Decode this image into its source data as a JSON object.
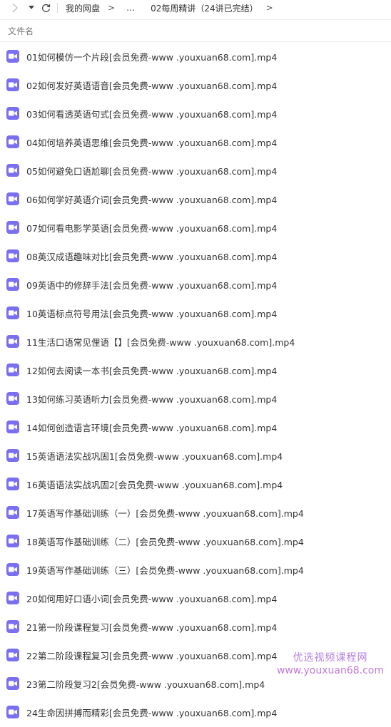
{
  "toolbar": {
    "breadcrumb_root": "我的网盘",
    "breadcrumb_ellipsis": "…",
    "breadcrumb_current": "02每周精讲（24讲已完结）",
    "separator": ">"
  },
  "column_header": {
    "name": "文件名"
  },
  "colors": {
    "video_icon": "#7a6ff0",
    "watermark": "#c07ad8"
  },
  "files": [
    "01如何模仿一个片段[会员免费-www .youxuan68.com].mp4",
    "02如何发好英语语音[会员免费-www .youxuan68.com].mp4",
    "03如何看透英语句式[会员免费-www .youxuan68.com].mp4",
    "04如何培养英语思维[会员免费-www .youxuan68.com].mp4",
    "05如何避免口语尬聊[会员免费-www .youxuan68.com].mp4",
    "06如何学好英语介词[会员免费-www .youxuan68.com].mp4",
    "07如何看电影学英语[会员免费-www .youxuan68.com].mp4",
    "08英汉成语趣味对比[会员免费-www .youxuan68.com].mp4",
    "09英语中的修辞手法[会员免费-www .youxuan68.com].mp4",
    "10英语标点符号用法[会员免费-www .youxuan68.com].mp4",
    "11生活口语常见俚语【】[会员免费-www .youxuan68.com].mp4",
    "12如何去阅读一本书[会员免费-www .youxuan68.com].mp4",
    "13如何练习英语听力[会员免费-www .youxuan68.com].mp4",
    "14如何创造语言环境[会员免费-www .youxuan68.com].mp4",
    "15英语语法实战巩固1[会员免费-www .youxuan68.com].mp4",
    "16英语语法实战巩固2[会员免费-www .youxuan68.com].mp4",
    "17英语写作基础训练（一）[会员免费-www .youxuan68.com].mp4",
    "18英语写作基础训练（二）[会员免费-www .youxuan68.com].mp4",
    "19英语写作基础训练（三）[会员免费-www .youxuan68.com].mp4",
    "20如何用好口语小词[会员免费-www .youxuan68.com].mp4",
    "21第一阶段课程复习[会员免费-www .youxuan68.com].mp4",
    "22第二阶段课程复习[会员免费-www .youxuan68.com].mp4",
    "23第二阶段复习2[会员免费-www .youxuan68.com].mp4",
    "24生命因拼搏而精彩[会员免费-www .youxuan68.com].mp4"
  ],
  "watermark": {
    "title": "优选视频课程网",
    "url": "www.youxuan68.com"
  }
}
